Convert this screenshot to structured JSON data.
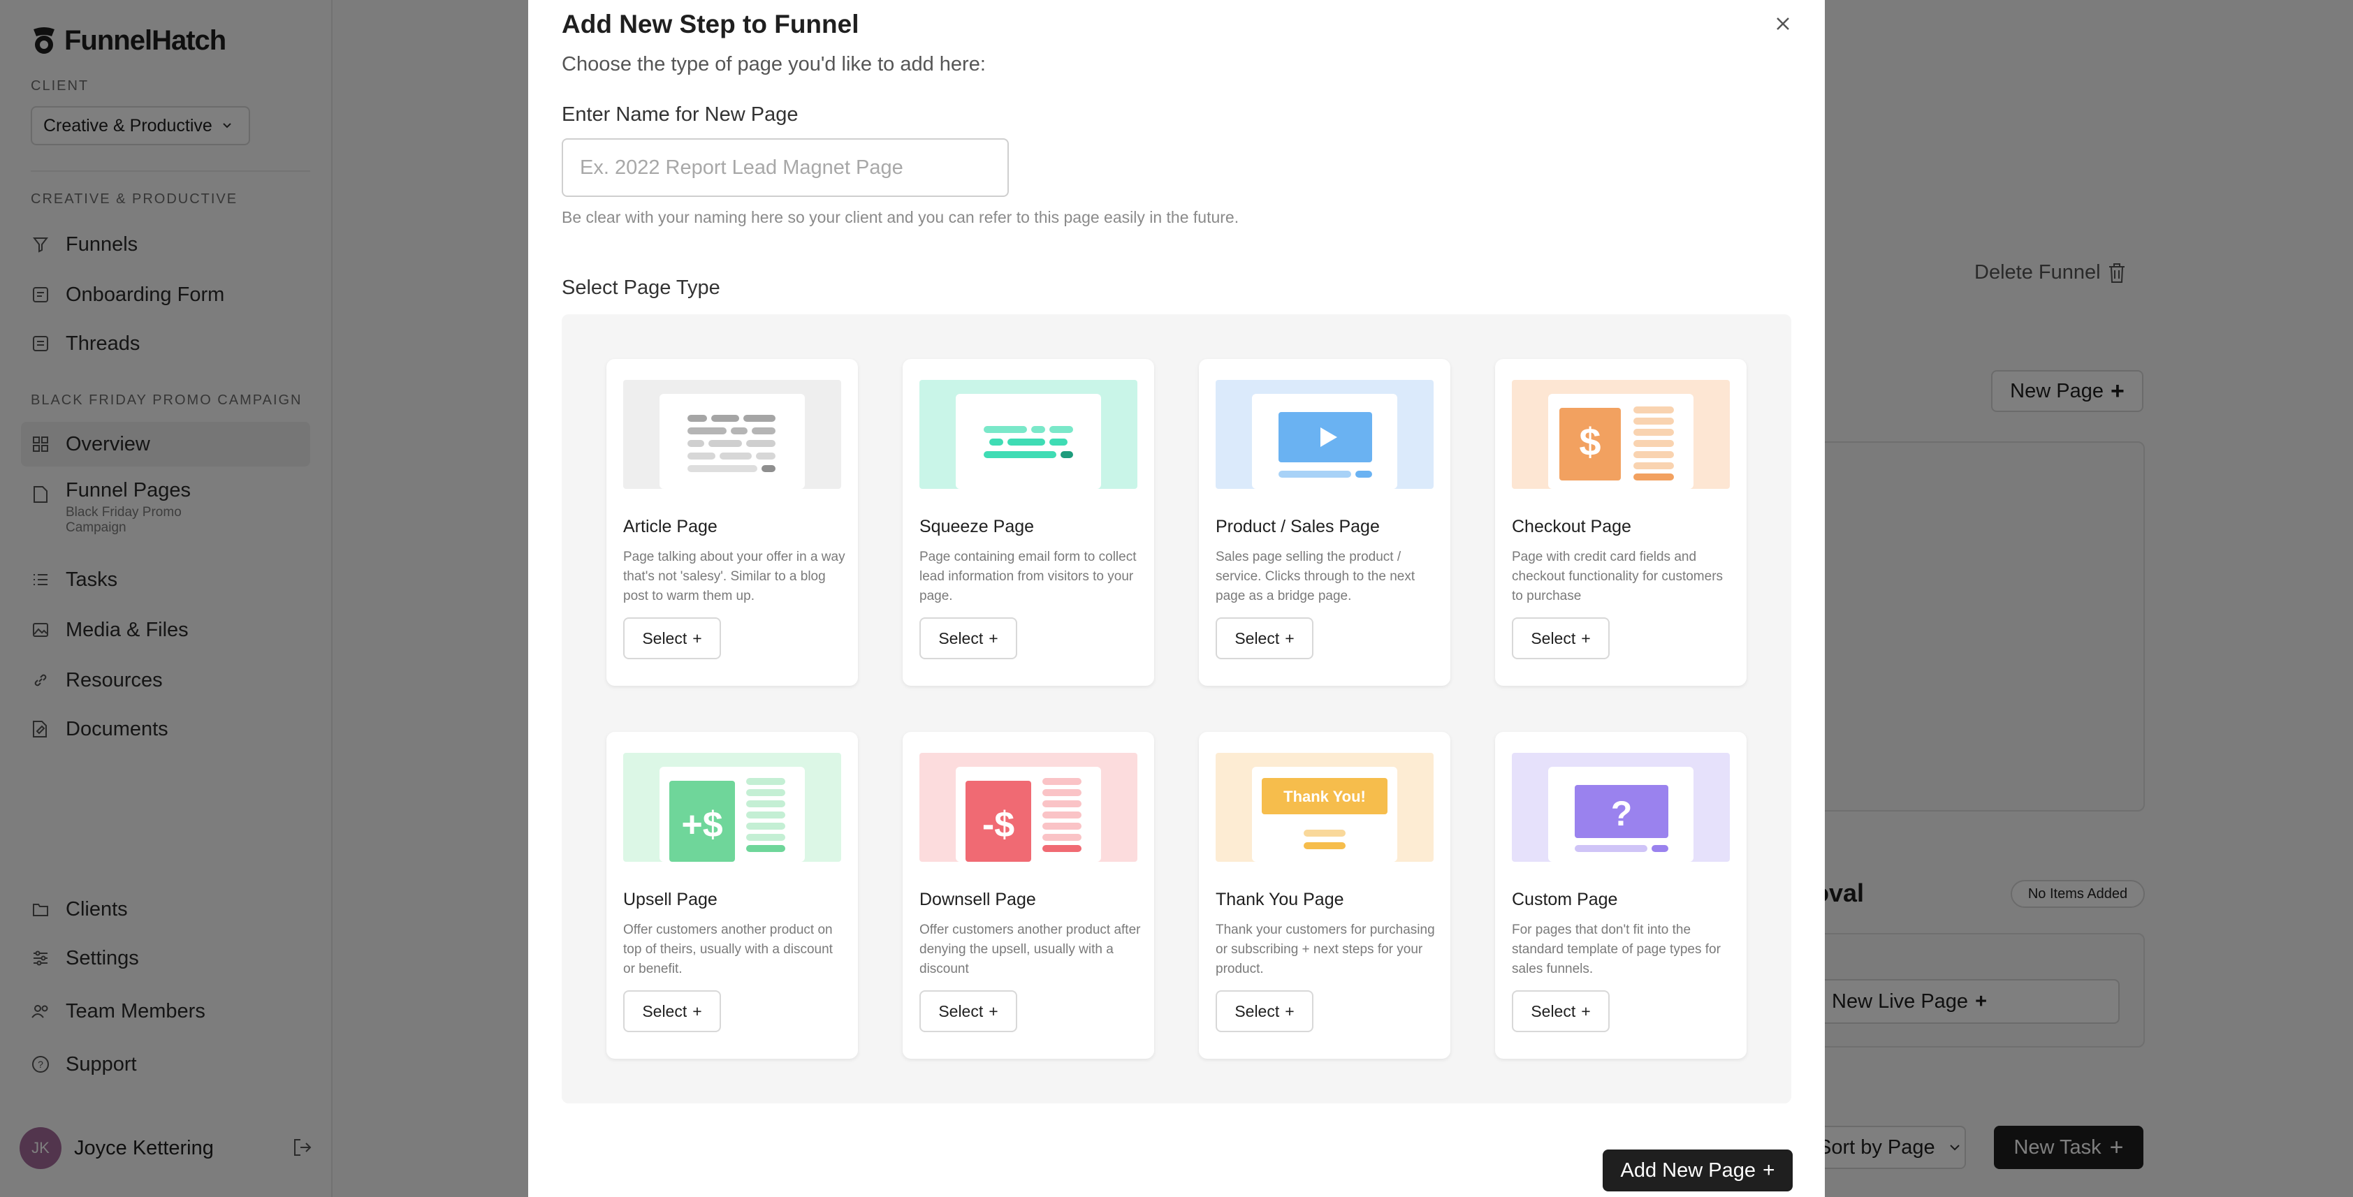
{
  "app": {
    "name": "FunnelHatch"
  },
  "sidebar": {
    "client_label": "CLIENT",
    "client_value": "Creative & Productive",
    "section1_label": "CREATIVE & PRODUCTIVE",
    "section1_items": [
      {
        "label": "Funnels",
        "icon": "funnel-icon"
      },
      {
        "label": "Onboarding Form",
        "icon": "form-icon"
      },
      {
        "label": "Threads",
        "icon": "threads-icon"
      }
    ],
    "section2_label": "BLACK FRIDAY PROMO CAMPAIGN",
    "section2_items": [
      {
        "label": "Overview",
        "icon": "grid-icon"
      },
      {
        "label": "Funnel Pages",
        "sub": "Black Friday Promo Campaign",
        "icon": "page-icon"
      },
      {
        "label": "Tasks",
        "icon": "tasks-icon"
      },
      {
        "label": "Media & Files",
        "icon": "image-icon"
      },
      {
        "label": "Resources",
        "icon": "link-icon"
      },
      {
        "label": "Documents",
        "icon": "document-icon"
      }
    ],
    "bottom_items": [
      {
        "label": "Clients",
        "icon": "folder-icon"
      },
      {
        "label": "Settings",
        "icon": "sliders-icon"
      },
      {
        "label": "Team Members",
        "icon": "team-icon"
      },
      {
        "label": "Support",
        "icon": "help-icon"
      }
    ],
    "user": {
      "initials": "JK",
      "name": "Joyce Kettering"
    }
  },
  "background": {
    "delete_funnel": "Delete Funnel",
    "new_page": "New Page",
    "approval_fragment": "oval",
    "no_items": "No Items Added",
    "new_live_page": "New Live Page",
    "sort_by": "Sort by Page",
    "new_task": "New Task"
  },
  "modal": {
    "title": "Add New Step to Funnel",
    "subtitle": "Choose the type of page you'd like to add here:",
    "name_label": "Enter Name for New Page",
    "name_placeholder": "Ex. 2022 Report Lead Magnet Page",
    "name_value": "",
    "name_help": "Be clear with your naming here so your client and you can refer to this page easily in the future.",
    "type_label": "Select Page Type",
    "select_label": "Select",
    "add_button": "Add New Page",
    "page_types": [
      {
        "title": "Article Page",
        "desc": "Page talking about your offer in a way that's not 'salesy'. Similar to a blog post to warm them up.",
        "accent": "#8f8f8f",
        "bg": "#eeeeee"
      },
      {
        "title": "Squeeze Page",
        "desc": "Page containing email form to collect lead information from visitors to your page.",
        "accent": "#3fdcb4",
        "bg": "#c9f5e8"
      },
      {
        "title": "Product / Sales Page",
        "desc": "Sales page selling the product / service. Clicks through to the next page as a bridge page.",
        "accent": "#6ab2f2",
        "bg": "#dbeafb"
      },
      {
        "title": "Checkout Page",
        "desc": "Page with credit card fields and checkout functionality for customers to purchase",
        "accent": "#f2a160",
        "bg": "#fde6d3"
      },
      {
        "title": "Upsell Page",
        "desc": "Offer customers another product on top of theirs, usually with a discount or benefit.",
        "accent": "#6fd69a",
        "bg": "#dcf7e6",
        "glyph": "+$"
      },
      {
        "title": "Downsell Page",
        "desc": "Offer customers another product after denying the upsell, usually with a discount",
        "accent": "#f06a73",
        "bg": "#fcdcdd",
        "glyph": "-$"
      },
      {
        "title": "Thank You Page",
        "desc": "Thank your customers for purchasing or subscribing + next steps for your product.",
        "accent": "#f6bd4c",
        "bg": "#fdecd3",
        "glyph": "Thank You!"
      },
      {
        "title": "Custom Page",
        "desc": "For pages that don't fit into the standard template of page types for sales funnels.",
        "accent": "#9a82ee",
        "bg": "#e6e1fb",
        "glyph": "?"
      }
    ]
  }
}
